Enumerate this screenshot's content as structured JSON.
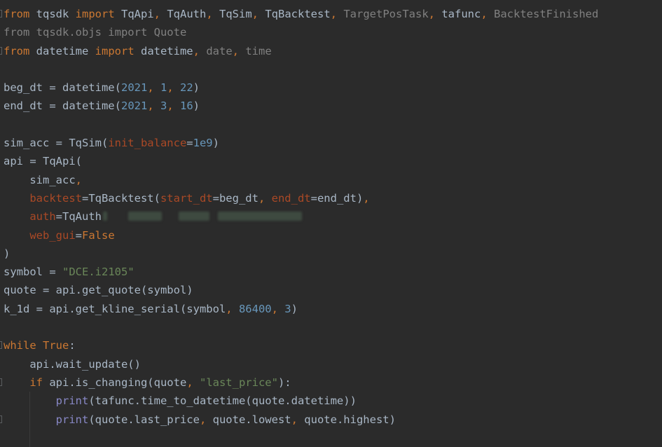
{
  "editor": {
    "lines": [
      {
        "fold": true,
        "guide": false,
        "tokens": [
          {
            "t": "from",
            "k": "kw"
          },
          {
            "t": " tqsdk ",
            "k": "pl"
          },
          {
            "t": "import",
            "k": "kw"
          },
          {
            "t": " TqApi",
            "k": "pl"
          },
          {
            "t": ", ",
            "k": "kw"
          },
          {
            "t": "TqAuth",
            "k": "pl"
          },
          {
            "t": ", ",
            "k": "kw"
          },
          {
            "t": "TqSim",
            "k": "pl"
          },
          {
            "t": ", ",
            "k": "kw"
          },
          {
            "t": "TqBacktest",
            "k": "pl"
          },
          {
            "t": ", ",
            "k": "kw"
          },
          {
            "t": "TargetPosTask",
            "k": "gray"
          },
          {
            "t": ", ",
            "k": "kw"
          },
          {
            "t": "tafunc",
            "k": "pl"
          },
          {
            "t": ", ",
            "k": "kw"
          },
          {
            "t": "BacktestFinished",
            "k": "gray"
          }
        ]
      },
      {
        "fold": false,
        "guide": false,
        "tokens": [
          {
            "t": "from tqsdk.objs import Quote",
            "k": "gray"
          }
        ]
      },
      {
        "fold": true,
        "guide": false,
        "tokens": [
          {
            "t": "from",
            "k": "kw"
          },
          {
            "t": " datetime ",
            "k": "pl"
          },
          {
            "t": "import",
            "k": "kw"
          },
          {
            "t": " datetime",
            "k": "pl"
          },
          {
            "t": ", ",
            "k": "kw"
          },
          {
            "t": "date",
            "k": "gray"
          },
          {
            "t": ", ",
            "k": "kw"
          },
          {
            "t": "time",
            "k": "gray"
          }
        ]
      },
      {
        "fold": false,
        "guide": false,
        "tokens": []
      },
      {
        "fold": false,
        "guide": false,
        "tokens": [
          {
            "t": "beg_dt = datetime(",
            "k": "pl"
          },
          {
            "t": "2021",
            "k": "num"
          },
          {
            "t": ", ",
            "k": "kw"
          },
          {
            "t": "1",
            "k": "num"
          },
          {
            "t": ", ",
            "k": "kw"
          },
          {
            "t": "22",
            "k": "num"
          },
          {
            "t": ")",
            "k": "pl"
          }
        ]
      },
      {
        "fold": false,
        "guide": false,
        "tokens": [
          {
            "t": "end_dt = datetime(",
            "k": "pl"
          },
          {
            "t": "2021",
            "k": "num"
          },
          {
            "t": ", ",
            "k": "kw"
          },
          {
            "t": "3",
            "k": "num"
          },
          {
            "t": ", ",
            "k": "kw"
          },
          {
            "t": "16",
            "k": "num"
          },
          {
            "t": ")",
            "k": "pl"
          }
        ]
      },
      {
        "fold": false,
        "guide": false,
        "tokens": []
      },
      {
        "fold": false,
        "guide": false,
        "tokens": [
          {
            "t": "sim_acc = TqSim(",
            "k": "pl"
          },
          {
            "t": "init_balance",
            "k": "param"
          },
          {
            "t": "=",
            "k": "pl"
          },
          {
            "t": "1e9",
            "k": "num"
          },
          {
            "t": ")",
            "k": "pl"
          }
        ]
      },
      {
        "fold": false,
        "guide": false,
        "tokens": [
          {
            "t": "api = TqApi(",
            "k": "pl"
          }
        ]
      },
      {
        "fold": false,
        "guide": false,
        "tokens": [
          {
            "t": "    sim_acc",
            "k": "pl"
          },
          {
            "t": ",",
            "k": "kw"
          }
        ]
      },
      {
        "fold": false,
        "guide": false,
        "tokens": [
          {
            "t": "    ",
            "k": "pl"
          },
          {
            "t": "backtest",
            "k": "param"
          },
          {
            "t": "=TqBacktest(",
            "k": "pl"
          },
          {
            "t": "start_dt",
            "k": "param"
          },
          {
            "t": "=beg_dt",
            "k": "pl"
          },
          {
            "t": ", ",
            "k": "kw"
          },
          {
            "t": "end_dt",
            "k": "param"
          },
          {
            "t": "=end_dt)",
            "k": "pl"
          },
          {
            "t": ",",
            "k": "kw"
          }
        ]
      },
      {
        "fold": false,
        "guide": false,
        "redacted": true,
        "tokens": [
          {
            "t": "    ",
            "k": "pl"
          },
          {
            "t": "auth",
            "k": "param"
          },
          {
            "t": "=TqAuth",
            "k": "pl"
          }
        ]
      },
      {
        "fold": false,
        "guide": false,
        "tokens": [
          {
            "t": "    ",
            "k": "pl"
          },
          {
            "t": "web_gui",
            "k": "param"
          },
          {
            "t": "=",
            "k": "pl"
          },
          {
            "t": "False",
            "k": "kw"
          }
        ]
      },
      {
        "fold": false,
        "guide": false,
        "tokens": [
          {
            "t": ")",
            "k": "pl"
          }
        ]
      },
      {
        "fold": false,
        "guide": false,
        "tokens": [
          {
            "t": "symbol = ",
            "k": "pl"
          },
          {
            "t": "\"DCE.i2105\"",
            "k": "str"
          }
        ]
      },
      {
        "fold": false,
        "guide": false,
        "tokens": [
          {
            "t": "quote = api.get_quote(symbol)",
            "k": "pl"
          }
        ]
      },
      {
        "fold": false,
        "guide": false,
        "tokens": [
          {
            "t": "k_1d = api.get_kline_serial(symbol",
            "k": "pl"
          },
          {
            "t": ", ",
            "k": "kw"
          },
          {
            "t": "86400",
            "k": "num"
          },
          {
            "t": ", ",
            "k": "kw"
          },
          {
            "t": "3",
            "k": "num"
          },
          {
            "t": ")",
            "k": "pl"
          }
        ]
      },
      {
        "fold": false,
        "guide": false,
        "tokens": []
      },
      {
        "fold": true,
        "guide": false,
        "tokens": [
          {
            "t": "while",
            "k": "kw"
          },
          {
            "t": " ",
            "k": "pl"
          },
          {
            "t": "True",
            "k": "kw"
          },
          {
            "t": ":",
            "k": "pl"
          }
        ]
      },
      {
        "fold": false,
        "guide": false,
        "tokens": [
          {
            "t": "    api.wait_update()",
            "k": "pl"
          }
        ]
      },
      {
        "fold": true,
        "guide": false,
        "tokens": [
          {
            "t": "    ",
            "k": "pl"
          },
          {
            "t": "if",
            "k": "kw"
          },
          {
            "t": " api.is_changing(quote",
            "k": "pl"
          },
          {
            "t": ", ",
            "k": "kw"
          },
          {
            "t": "\"last_price\"",
            "k": "str"
          },
          {
            "t": "):",
            "k": "pl"
          }
        ]
      },
      {
        "fold": false,
        "guide": true,
        "tokens": [
          {
            "t": "        ",
            "k": "pl"
          },
          {
            "t": "print",
            "k": "purp"
          },
          {
            "t": "(tafunc.time_to_datetime(quote.datetime))",
            "k": "pl"
          }
        ]
      },
      {
        "fold": true,
        "guide": true,
        "tokens": [
          {
            "t": "        ",
            "k": "pl"
          },
          {
            "t": "print",
            "k": "purp"
          },
          {
            "t": "(quote.last_price",
            "k": "pl"
          },
          {
            "t": ", ",
            "k": "kw"
          },
          {
            "t": "quote.lowest",
            "k": "pl"
          },
          {
            "t": ", ",
            "k": "kw"
          },
          {
            "t": "quote.highest)",
            "k": "pl"
          }
        ]
      },
      {
        "fold": false,
        "guide": true,
        "tokens": []
      }
    ]
  }
}
